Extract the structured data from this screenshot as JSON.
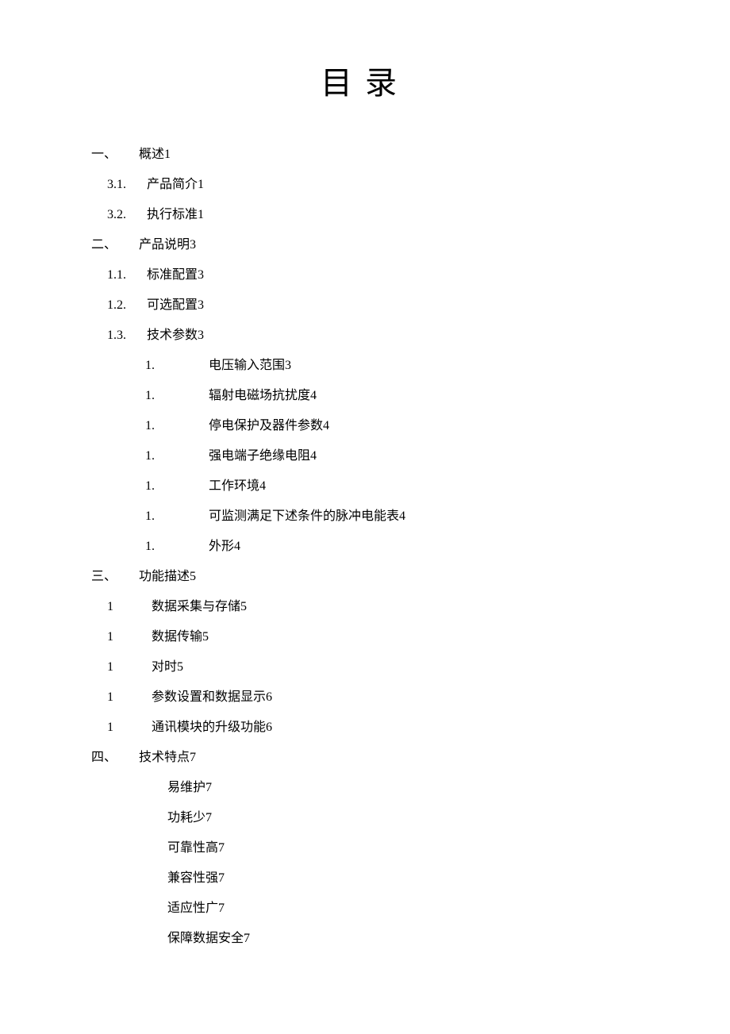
{
  "title": "目录",
  "lines": [
    {
      "indent": "indent-0",
      "numClass": "num-col-a",
      "num": "一、",
      "text": "概述1"
    },
    {
      "indent": "indent-1",
      "numClass": "num-col-b",
      "num": "3.1.",
      "text": "产品简介1"
    },
    {
      "indent": "indent-1",
      "numClass": "num-col-b",
      "num": "3.2.",
      "text": "执行标准1"
    },
    {
      "indent": "indent-0",
      "numClass": "num-col-a",
      "num": "二、",
      "text": "产品说明3"
    },
    {
      "indent": "indent-1",
      "numClass": "num-col-b",
      "num": "1.1.",
      "text": "标准配置3"
    },
    {
      "indent": "indent-1",
      "numClass": "num-col-b",
      "num": "1.2.",
      "text": "可选配置3"
    },
    {
      "indent": "indent-1",
      "numClass": "num-col-b",
      "num": "1.3.",
      "text": "技术参数3"
    },
    {
      "indent": "indent-2",
      "numClass": "num-col-c",
      "num": "1.",
      "text": "电压输入范围3"
    },
    {
      "indent": "indent-2",
      "numClass": "num-col-c",
      "num": "1.",
      "text": "辐射电磁场抗扰度4"
    },
    {
      "indent": "indent-2",
      "numClass": "num-col-c",
      "num": "1.",
      "text": "停电保护及器件参数4"
    },
    {
      "indent": "indent-2",
      "numClass": "num-col-c",
      "num": "1.",
      "text": "强电端子绝缘电阻4"
    },
    {
      "indent": "indent-2",
      "numClass": "num-col-c",
      "num": "1.",
      "text": "工作环境4"
    },
    {
      "indent": "indent-2",
      "numClass": "num-col-c",
      "num": "1.",
      "text": "可监测满足下述条件的脉冲电能表4"
    },
    {
      "indent": "indent-2",
      "numClass": "num-col-c",
      "num": "1.",
      "text": "外形4"
    },
    {
      "indent": "indent-0",
      "numClass": "num-col-a",
      "num": "三、",
      "text": "功能描述5"
    },
    {
      "indent": "indent-1",
      "numClass": "num-col-d",
      "num": "1",
      "text": "数据采集与存储5"
    },
    {
      "indent": "indent-1",
      "numClass": "num-col-d",
      "num": "1",
      "text": "数据传输5"
    },
    {
      "indent": "indent-1",
      "numClass": "num-col-d",
      "num": "1",
      "text": "对时5"
    },
    {
      "indent": "indent-1",
      "numClass": "num-col-d",
      "num": "1",
      "text": "参数设置和数据显示6"
    },
    {
      "indent": "indent-1",
      "numClass": "num-col-d",
      "num": "1",
      "text": "通讯模块的升级功能6"
    },
    {
      "indent": "indent-0",
      "numClass": "num-col-a",
      "num": "四、",
      "text": "技术特点7"
    },
    {
      "indent": "indent-3",
      "numClass": "",
      "num": "",
      "text": "易维护7"
    },
    {
      "indent": "indent-3",
      "numClass": "",
      "num": "",
      "text": "功耗少7"
    },
    {
      "indent": "indent-3",
      "numClass": "",
      "num": "",
      "text": "可靠性高7"
    },
    {
      "indent": "indent-3",
      "numClass": "",
      "num": "",
      "text": "兼容性强7"
    },
    {
      "indent": "indent-3",
      "numClass": "",
      "num": "",
      "text": "适应性广7"
    },
    {
      "indent": "indent-3",
      "numClass": "",
      "num": "",
      "text": "保障数据安全7"
    }
  ]
}
